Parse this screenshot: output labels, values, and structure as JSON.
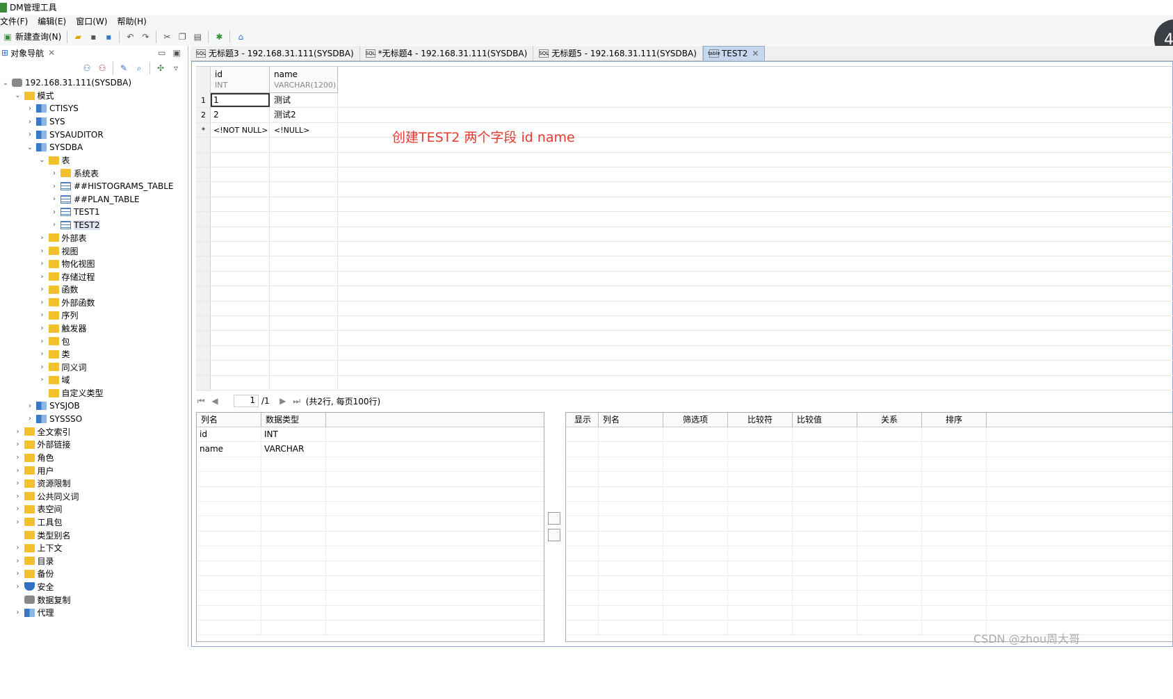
{
  "app": {
    "title": "DM管理工具",
    "avatar_text": "4"
  },
  "menu": [
    "文件(F)",
    "编辑(E)",
    "窗口(W)",
    "帮助(H)"
  ],
  "toolbar": {
    "new_query": "新建查询(N)"
  },
  "nav": {
    "title": "对象导航",
    "tree": [
      {
        "label": "192.168.31.111(SYSDBA)",
        "level": 0,
        "icon": "db",
        "expanded": true
      },
      {
        "label": "模式",
        "level": 1,
        "icon": "folder",
        "expanded": true
      },
      {
        "label": "CTISYS",
        "level": 2,
        "icon": "schema",
        "expanded": false
      },
      {
        "label": "SYS",
        "level": 2,
        "icon": "schema",
        "expanded": false
      },
      {
        "label": "SYSAUDITOR",
        "level": 2,
        "icon": "schema",
        "expanded": false
      },
      {
        "label": "SYSDBA",
        "level": 2,
        "icon": "schema",
        "expanded": true
      },
      {
        "label": "表",
        "level": 3,
        "icon": "folder",
        "expanded": true
      },
      {
        "label": "系统表",
        "level": 4,
        "icon": "folder",
        "expanded": false
      },
      {
        "label": "##HISTOGRAMS_TABLE",
        "level": 4,
        "icon": "table",
        "expanded": false
      },
      {
        "label": "##PLAN_TABLE",
        "level": 4,
        "icon": "table",
        "expanded": false
      },
      {
        "label": "TEST1",
        "level": 4,
        "icon": "table",
        "expanded": false
      },
      {
        "label": "TEST2",
        "level": 4,
        "icon": "table",
        "expanded": false,
        "selected": true
      },
      {
        "label": "外部表",
        "level": 3,
        "icon": "folder",
        "expanded": false
      },
      {
        "label": "视图",
        "level": 3,
        "icon": "folder",
        "expanded": false
      },
      {
        "label": "物化视图",
        "level": 3,
        "icon": "folder",
        "expanded": false
      },
      {
        "label": "存储过程",
        "level": 3,
        "icon": "folder",
        "expanded": false
      },
      {
        "label": "函数",
        "level": 3,
        "icon": "folder",
        "expanded": false
      },
      {
        "label": "外部函数",
        "level": 3,
        "icon": "folder",
        "expanded": false
      },
      {
        "label": "序列",
        "level": 3,
        "icon": "folder",
        "expanded": false
      },
      {
        "label": "触发器",
        "level": 3,
        "icon": "folder",
        "expanded": false
      },
      {
        "label": "包",
        "level": 3,
        "icon": "folder",
        "expanded": false
      },
      {
        "label": "类",
        "level": 3,
        "icon": "folder",
        "expanded": false
      },
      {
        "label": "同义词",
        "level": 3,
        "icon": "folder",
        "expanded": false
      },
      {
        "label": "域",
        "level": 3,
        "icon": "folder",
        "expanded": false
      },
      {
        "label": "自定义类型",
        "level": 3,
        "icon": "folder",
        "noarrow": true
      },
      {
        "label": "SYSJOB",
        "level": 2,
        "icon": "schema",
        "expanded": false
      },
      {
        "label": "SYSSSO",
        "level": 2,
        "icon": "schema",
        "expanded": false
      },
      {
        "label": "全文索引",
        "level": 1,
        "icon": "folder",
        "expanded": false
      },
      {
        "label": "外部链接",
        "level": 1,
        "icon": "folder",
        "expanded": false
      },
      {
        "label": "角色",
        "level": 1,
        "icon": "folder",
        "expanded": false
      },
      {
        "label": "用户",
        "level": 1,
        "icon": "folder",
        "expanded": false
      },
      {
        "label": "资源限制",
        "level": 1,
        "icon": "folder",
        "expanded": false
      },
      {
        "label": "公共同义词",
        "level": 1,
        "icon": "folder",
        "expanded": false
      },
      {
        "label": "表空间",
        "level": 1,
        "icon": "folder",
        "expanded": false
      },
      {
        "label": "工具包",
        "level": 1,
        "icon": "folder",
        "expanded": false
      },
      {
        "label": "类型别名",
        "level": 1,
        "icon": "folder",
        "noarrow": true
      },
      {
        "label": "上下文",
        "level": 1,
        "icon": "folder",
        "expanded": false
      },
      {
        "label": "目录",
        "level": 1,
        "icon": "folder",
        "expanded": false
      },
      {
        "label": "备份",
        "level": 1,
        "icon": "folder",
        "expanded": false
      },
      {
        "label": "安全",
        "level": 1,
        "icon": "shield",
        "expanded": false
      },
      {
        "label": "数据复制",
        "level": 1,
        "icon": "db",
        "noarrow": true
      },
      {
        "label": "代理",
        "level": 1,
        "icon": "schema",
        "expanded": false
      }
    ]
  },
  "tabs": [
    {
      "label": "无标题3 - 192.168.31.111(SYSDBA)",
      "icon": "SQL"
    },
    {
      "label": "*无标题4 - 192.168.31.111(SYSDBA)",
      "icon": "SQL"
    },
    {
      "label": "无标题5 - 192.168.31.111(SYSDBA)",
      "icon": "SQL"
    },
    {
      "label": "TEST2",
      "icon": "table",
      "active": true
    }
  ],
  "datagrid": {
    "columns": [
      {
        "name": "id",
        "type": "INT"
      },
      {
        "name": "name",
        "type": "VARCHAR(1200)"
      }
    ],
    "rows": [
      {
        "num": "1",
        "cells": [
          "1",
          "测试"
        ]
      },
      {
        "num": "2",
        "cells": [
          "2",
          "测试2"
        ]
      },
      {
        "num": "*",
        "cells": [
          "<!NOT NULL>",
          "<!NULL>"
        ]
      }
    ]
  },
  "annotation": "创建TEST2 两个字段 id name",
  "pager": {
    "page": "1",
    "total": "/1",
    "summary": "(共2行, 每页100行)"
  },
  "column_panel": {
    "headers": [
      "列名",
      "数据类型"
    ],
    "rows": [
      [
        "id",
        "INT"
      ],
      [
        "name",
        "VARCHAR"
      ]
    ]
  },
  "filter_panel": {
    "headers": [
      "显示",
      "列名",
      "筛选项",
      "比较符",
      "比较值",
      "关系",
      "排序"
    ]
  },
  "watermark": "CSDN @zhou周大哥"
}
